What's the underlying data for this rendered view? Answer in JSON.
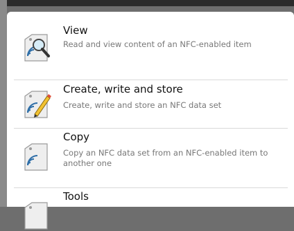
{
  "menu": {
    "items": [
      {
        "title": "View",
        "description": "Read and view content of an NFC-enabled item",
        "icon": "tag-magnifier-icon"
      },
      {
        "title": "Create, write and store",
        "description": "Create, write and store an NFC data set",
        "icon": "tag-pencil-icon"
      },
      {
        "title": "Copy",
        "description": "Copy an NFC data set from an NFC-enabled item to another one",
        "icon": "tag-copy-icon"
      },
      {
        "title": "Tools",
        "description": "",
        "icon": "tag-tools-icon"
      }
    ]
  },
  "colors": {
    "title": "#111111",
    "description": "#777777",
    "divider": "#d9d9d9",
    "icon_blue": "#2f6fa8"
  }
}
